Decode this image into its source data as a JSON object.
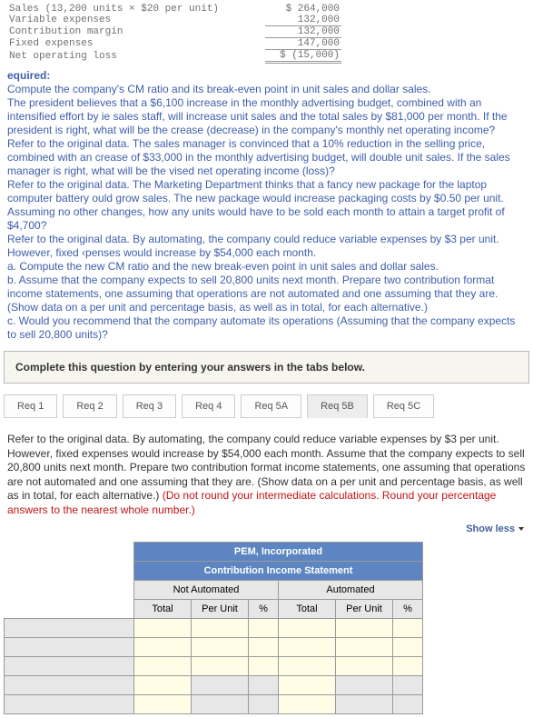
{
  "top_table": {
    "rows": [
      {
        "label": "Sales (13,200 units × $20 per unit)",
        "pre": "$",
        "val": "264,000"
      },
      {
        "label": "Variable expenses",
        "pre": "",
        "val": "132,000"
      },
      {
        "label": "Contribution margin",
        "pre": "",
        "val": "132,000"
      },
      {
        "label": "Fixed expenses",
        "pre": "",
        "val": "147,000"
      },
      {
        "label": "Net operating loss",
        "pre": "$",
        "val": "(15,000)"
      }
    ]
  },
  "prose": {
    "heading": "equired:",
    "p1": "Compute the company's CM ratio and its break-even point in unit sales and dollar sales.",
    "p2": "The president believes that a $6,100 increase in the monthly advertising budget, combined with an intensified effort by ie sales staff, will increase unit sales and the total sales by $81,000 per month. If the president is right, what will be the crease (decrease) in the company's monthly net operating income?",
    "p3": "Refer to the original data. The sales manager is convinced that a 10% reduction in the selling price, combined with an crease of $33,000 in the monthly advertising budget, will double unit sales. If the sales manager is right, what will be the vised net operating income (loss)?",
    "p4": "Refer to the original data. The Marketing Department thinks that a fancy new package for the laptop computer battery ould grow sales. The new package would increase packaging costs by $0.50 per unit. Assuming no other changes, how any units would have to be sold each month to attain a target profit of $4,700?",
    "p5": "Refer to the original data. By automating, the company could reduce variable expenses by $3 per unit. However, fixed ‹penses would increase by $54,000 each month.",
    "pa": "a. Compute the new CM ratio and the new break-even point in unit sales and dollar sales.",
    "pb": "b. Assume that the company expects to sell 20,800 units next month. Prepare two contribution format income statements, one assuming that operations are not automated and one assuming that they are. (Show data on a per unit and percentage basis, as well as in total, for each alternative.)",
    "pc": "c. Would you recommend that the company automate its operations (Assuming that the company expects to sell 20,800 units)?"
  },
  "instruction": "Complete this question by entering your answers in the tabs below.",
  "tabs": [
    "Req 1",
    "Req 2",
    "Req 3",
    "Req 4",
    "Req 5A",
    "Req 5B",
    "Req 5C"
  ],
  "refer": {
    "main": "Refer to the original data. By automating, the company could reduce variable expenses by $3 per unit. However, fixed expenses would increase by $54,000 each month. Assume that the company expects to sell 20,800 units next month. Prepare two contribution format income statements, one assuming that operations are not automated and one assuming that they are. (Show data on a per unit and percentage basis, as well as in total, for each alternative.) ",
    "red": "(Do not round your intermediate calculations. Round your percentage answers to the nearest whole number.)"
  },
  "showless": "Show less",
  "grid": {
    "title1": "PEM, Incorporated",
    "title2": "Contribution Income Statement",
    "group1": "Not Automated",
    "group2": "Automated",
    "cols": [
      "Total",
      "Per Unit",
      "%",
      "Total",
      "Per Unit",
      "%"
    ]
  }
}
